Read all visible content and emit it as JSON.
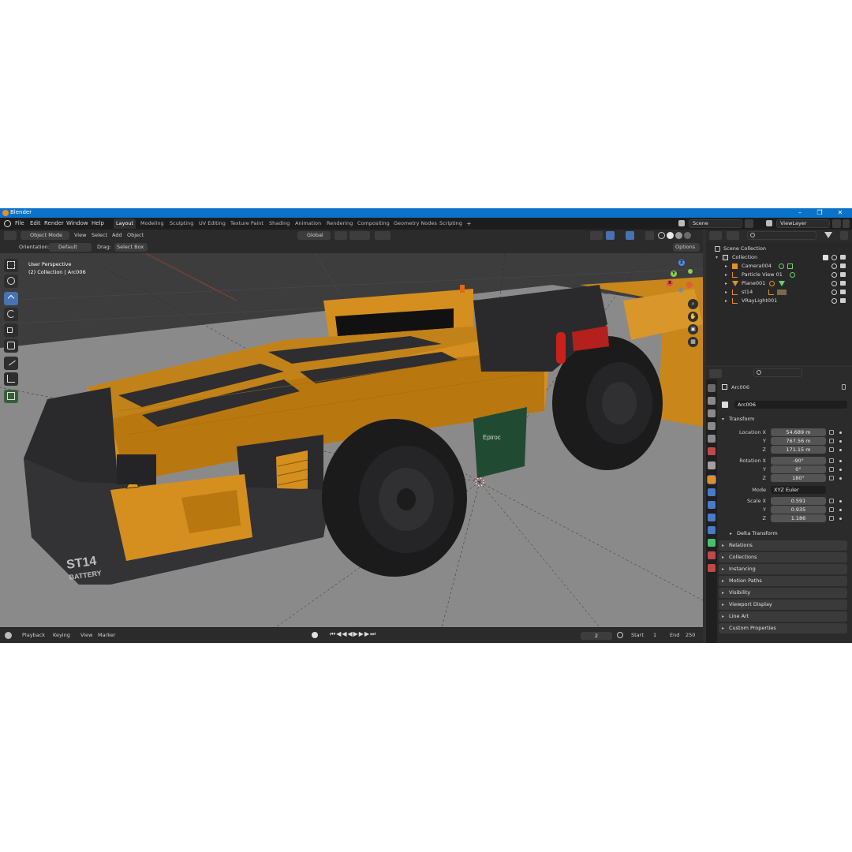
{
  "window": {
    "title": "Blender",
    "minimize": "–",
    "maximize": "❐",
    "close": "✕"
  },
  "menus": [
    "File",
    "Edit",
    "Render",
    "Window",
    "Help"
  ],
  "workspaces": [
    "Layout",
    "Modeling",
    "Sculpting",
    "UV Editing",
    "Texture Paint",
    "Shading",
    "Animation",
    "Rendering",
    "Compositing",
    "Geometry Nodes",
    "Scripting"
  ],
  "add_workspace": "+",
  "scene_field": "Scene",
  "viewlayer_field": "ViewLayer",
  "viewport_header": {
    "mode": "Object Mode",
    "menus": [
      "View",
      "Select",
      "Add",
      "Object"
    ],
    "transform_orientation": "Global"
  },
  "tool_settings": {
    "orientation_label": "Orientation:",
    "orientation_value": "Default",
    "drag_label": "Drag:",
    "drag_value": "Select Box",
    "options": "Options"
  },
  "viewport": {
    "perspective": "User Perspective",
    "collection": "(2) Collection | Arc006",
    "model_label_line1": "ST14",
    "model_label_line2": "BATTERY",
    "brand": "Epiroc",
    "gizmo": {
      "z": "Z",
      "y": "Y",
      "x": "X"
    }
  },
  "timeline": {
    "menus": [
      "Playback",
      "Keying",
      "View",
      "Marker"
    ],
    "current_frame": "2",
    "start_label": "Start",
    "start_value": "1",
    "end_label": "End",
    "end_value": "250"
  },
  "outliner": {
    "scene_collection": "Scene Collection",
    "collection": "Collection",
    "items": [
      "Camera004",
      "Particle View 01",
      "Plane001",
      "st14",
      "VRayLight001"
    ]
  },
  "properties": {
    "object_name": "Arc006",
    "object_field": "Arc006",
    "transform_header": "Transform",
    "location_label": "Location X",
    "location": [
      "54.689 m",
      "767.56 m",
      "171.15 m"
    ],
    "rotation_label": "Rotation X",
    "rotation": [
      "-90°",
      "0°",
      "180°"
    ],
    "mode_label": "Mode",
    "mode_value": "XYZ Euler",
    "scale_label": "Scale X",
    "scale": [
      "0.591",
      "0.935",
      "1.186"
    ],
    "axis_y": "Y",
    "axis_z": "Z",
    "delta_transform": "Delta Transform",
    "panels": [
      "Relations",
      "Collections",
      "Instancing",
      "Motion Paths",
      "Visibility",
      "Viewport Display",
      "Line Art",
      "Custom Properties"
    ]
  },
  "colors": {
    "accent": "#4772b3",
    "titlebar": "#0a72c8",
    "vehicle_body": "#d48f1f",
    "vehicle_dark": "#2a2a2c"
  }
}
